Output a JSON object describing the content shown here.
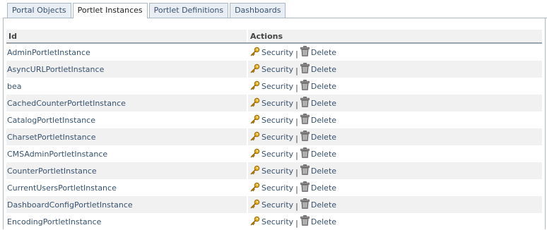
{
  "tabs": [
    {
      "label": "Portal Objects",
      "active": false
    },
    {
      "label": "Portlet Instances",
      "active": true
    },
    {
      "label": "Portlet Definitions",
      "active": false
    },
    {
      "label": "Dashboards",
      "active": false
    }
  ],
  "table": {
    "headers": {
      "id": "Id",
      "actions": "Actions"
    },
    "security_label": "Security",
    "separator": "|",
    "delete_label": "Delete",
    "rows": [
      {
        "id": "AdminPortletInstance"
      },
      {
        "id": "AsyncURLPortletInstance"
      },
      {
        "id": "bea"
      },
      {
        "id": "CachedCounterPortletInstance"
      },
      {
        "id": "CatalogPortletInstance"
      },
      {
        "id": "CharsetPortletInstance"
      },
      {
        "id": "CMSAdminPortletInstance"
      },
      {
        "id": "CounterPortletInstance"
      },
      {
        "id": "CurrentUsersPortletInstance"
      },
      {
        "id": "DashboardConfigPortletInstance"
      },
      {
        "id": "EncodingPortletInstance"
      }
    ]
  },
  "colors": {
    "link": "#38526f",
    "key_icon": "#d9a31c",
    "trash_icon": "#777777",
    "row_alt": "#f1f1f1"
  },
  "icons": {
    "security": "key-icon",
    "delete": "trash-icon"
  }
}
